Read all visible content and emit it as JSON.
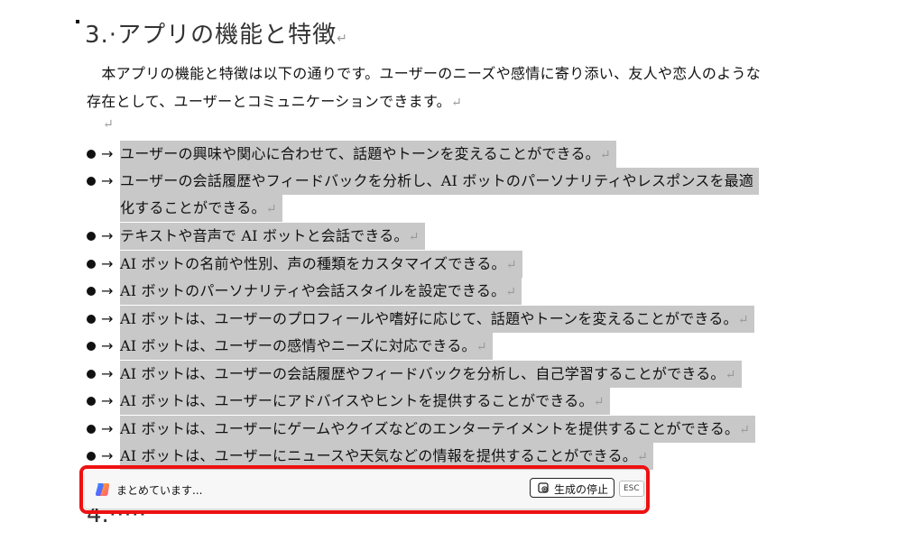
{
  "document": {
    "heading": "3.·アプリの機能と特徴",
    "paragraph_mark": "↵",
    "intro_line1": "本アプリの機能と特徴は以下の通りです。ユーザーのニーズや感情に寄り添い、友人や恋人のような",
    "intro_line2": "存在として、ユーザーとコミュニケーションできます。",
    "bullet_arrow": "→",
    "bullets": [
      "ユーザーの興味や関心に合わせて、話題やトーンを変えることができる。",
      "ユーザーの会話履歴やフィードバックを分析し、AI ボットのパーソナリティやレスポンスを最適",
      "化することができる。",
      "テキストや音声で AI ボットと会話できる。",
      "AI ボットの名前や性別、声の種類をカスタマイズできる。",
      "AI ボットのパーソナリティや会話スタイルを設定できる。",
      "AI ボットは、ユーザーのプロフィールや嗜好に応じて、話題やトーンを変えることができる。",
      "AI ボットは、ユーザーの感情やニーズに対応できる。",
      "AI ボットは、ユーザーの会話履歴やフィードバックを分析し、自己学習することができる。",
      "AI ボットは、ユーザーにアドバイスやヒントを提供することができる。",
      "AI ボットは、ユーザーにゲームやクイズなどのエンターテイメントを提供することができる。",
      "AI ボットは、ユーザーにニュースや天気などの情報を提供することができる。"
    ],
    "next_heading_partial": "4.·····",
    "next_para_partial": ""
  },
  "copilot_bar": {
    "status": "まとめています...",
    "stop_label": "生成の停止",
    "esc_label": "ESC",
    "highlight_color": "#ee1111"
  }
}
